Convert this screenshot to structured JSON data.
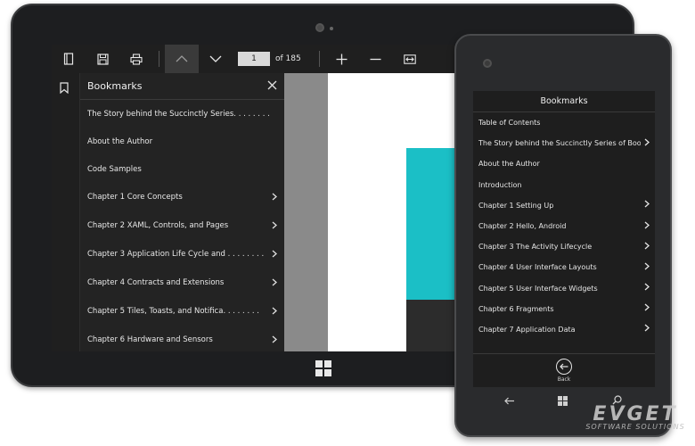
{
  "tablet": {
    "toolbar": {
      "icons": [
        "bookmark-panel-icon",
        "save-icon",
        "print-icon",
        "chevron-up-icon",
        "chevron-down-icon",
        "zoom-in-icon",
        "zoom-out-icon",
        "fit-width-icon"
      ],
      "page_number": "1",
      "page_total": "of 185"
    },
    "bookmarks": {
      "title": "Bookmarks",
      "items": [
        {
          "label": "The Story behind the Succinctly Series. . . . . . . .",
          "has_children": false
        },
        {
          "label": "About the Author",
          "has_children": false
        },
        {
          "label": "Code Samples",
          "has_children": false
        },
        {
          "label": "Chapter 1  Core Concepts",
          "has_children": true
        },
        {
          "label": "Chapter 2  XAML, Controls, and Pages",
          "has_children": true
        },
        {
          "label": "Chapter 3  Application Life Cycle and . . . . . . . .",
          "has_children": true
        },
        {
          "label": "Chapter 4  Contracts and Extensions",
          "has_children": true
        },
        {
          "label": "Chapter 5  Tiles, Toasts, and Notifica. . . . . . . .",
          "has_children": true
        },
        {
          "label": "Chapter 6  Hardware and Sensors",
          "has_children": true
        }
      ]
    },
    "colors": {
      "teal": "#1bbfc6",
      "panel": "#232323"
    }
  },
  "phone": {
    "title": "Bookmarks",
    "items": [
      {
        "label": "Table of Contents",
        "has_children": false
      },
      {
        "label": "The Story behind the Succinctly Series  of Book",
        "has_children": true
      },
      {
        "label": "About the Author",
        "has_children": false
      },
      {
        "label": "Introduction",
        "has_children": false
      },
      {
        "label": "Chapter 1  Setting Up",
        "has_children": true
      },
      {
        "label": "Chapter 2  Hello, Android",
        "has_children": true
      },
      {
        "label": "Chapter 3  The Activity Lifecycle",
        "has_children": true
      },
      {
        "label": "Chapter 4  User Interface Layouts",
        "has_children": true
      },
      {
        "label": "Chapter 5  User Interface Widgets",
        "has_children": true
      },
      {
        "label": "Chapter 6  Fragments",
        "has_children": true
      },
      {
        "label": "Chapter 7  Application Data",
        "has_children": true
      }
    ],
    "back_label": "Back"
  },
  "watermark": {
    "main": "EVGET",
    "sub": "SOFTWARE SOLUTIONS"
  }
}
